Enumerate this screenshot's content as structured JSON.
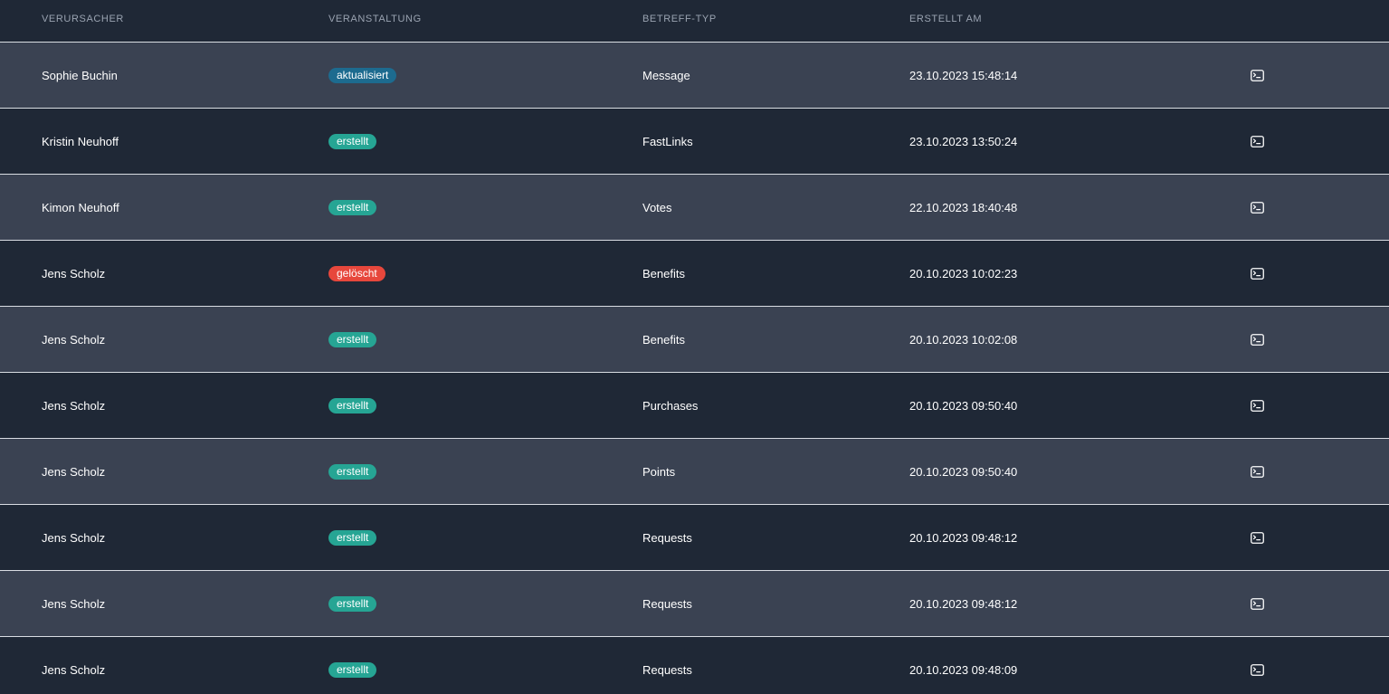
{
  "columns": {
    "verursacher": "Verursacher",
    "veranstaltung": "Veranstaltung",
    "betreff_typ": "Betreff-Typ",
    "erstellt_am": "Erstellt am"
  },
  "colors": {
    "aktualisiert": "#1d6b8f",
    "erstellt": "#26a594",
    "geloescht": "#e7473c",
    "row_alt": "#3a4252",
    "row_base": "#1f2836"
  },
  "rows": [
    {
      "user": "Sophie Buchin",
      "event": "aktualisiert",
      "event_type": "aktualisiert",
      "subject": "Message",
      "created": "23.10.2023 15:48:14",
      "icon": "terminal-icon"
    },
    {
      "user": "Kristin Neuhoff",
      "event": "erstellt",
      "event_type": "erstellt",
      "subject": "FastLinks",
      "created": "23.10.2023 13:50:24",
      "icon": "terminal-icon"
    },
    {
      "user": "Kimon Neuhoff",
      "event": "erstellt",
      "event_type": "erstellt",
      "subject": "Votes",
      "created": "22.10.2023 18:40:48",
      "icon": "terminal-icon"
    },
    {
      "user": "Jens Scholz",
      "event": "gelöscht",
      "event_type": "geloescht",
      "subject": "Benefits",
      "created": "20.10.2023 10:02:23",
      "icon": "terminal-icon"
    },
    {
      "user": "Jens Scholz",
      "event": "erstellt",
      "event_type": "erstellt",
      "subject": "Benefits",
      "created": "20.10.2023 10:02:08",
      "icon": "terminal-icon"
    },
    {
      "user": "Jens Scholz",
      "event": "erstellt",
      "event_type": "erstellt",
      "subject": "Purchases",
      "created": "20.10.2023 09:50:40",
      "icon": "terminal-icon"
    },
    {
      "user": "Jens Scholz",
      "event": "erstellt",
      "event_type": "erstellt",
      "subject": "Points",
      "created": "20.10.2023 09:50:40",
      "icon": "terminal-icon"
    },
    {
      "user": "Jens Scholz",
      "event": "erstellt",
      "event_type": "erstellt",
      "subject": "Requests",
      "created": "20.10.2023 09:48:12",
      "icon": "terminal-icon"
    },
    {
      "user": "Jens Scholz",
      "event": "erstellt",
      "event_type": "erstellt",
      "subject": "Requests",
      "created": "20.10.2023 09:48:12",
      "icon": "terminal-icon"
    },
    {
      "user": "Jens Scholz",
      "event": "erstellt",
      "event_type": "erstellt",
      "subject": "Requests",
      "created": "20.10.2023 09:48:09",
      "icon": "terminal-icon"
    }
  ]
}
